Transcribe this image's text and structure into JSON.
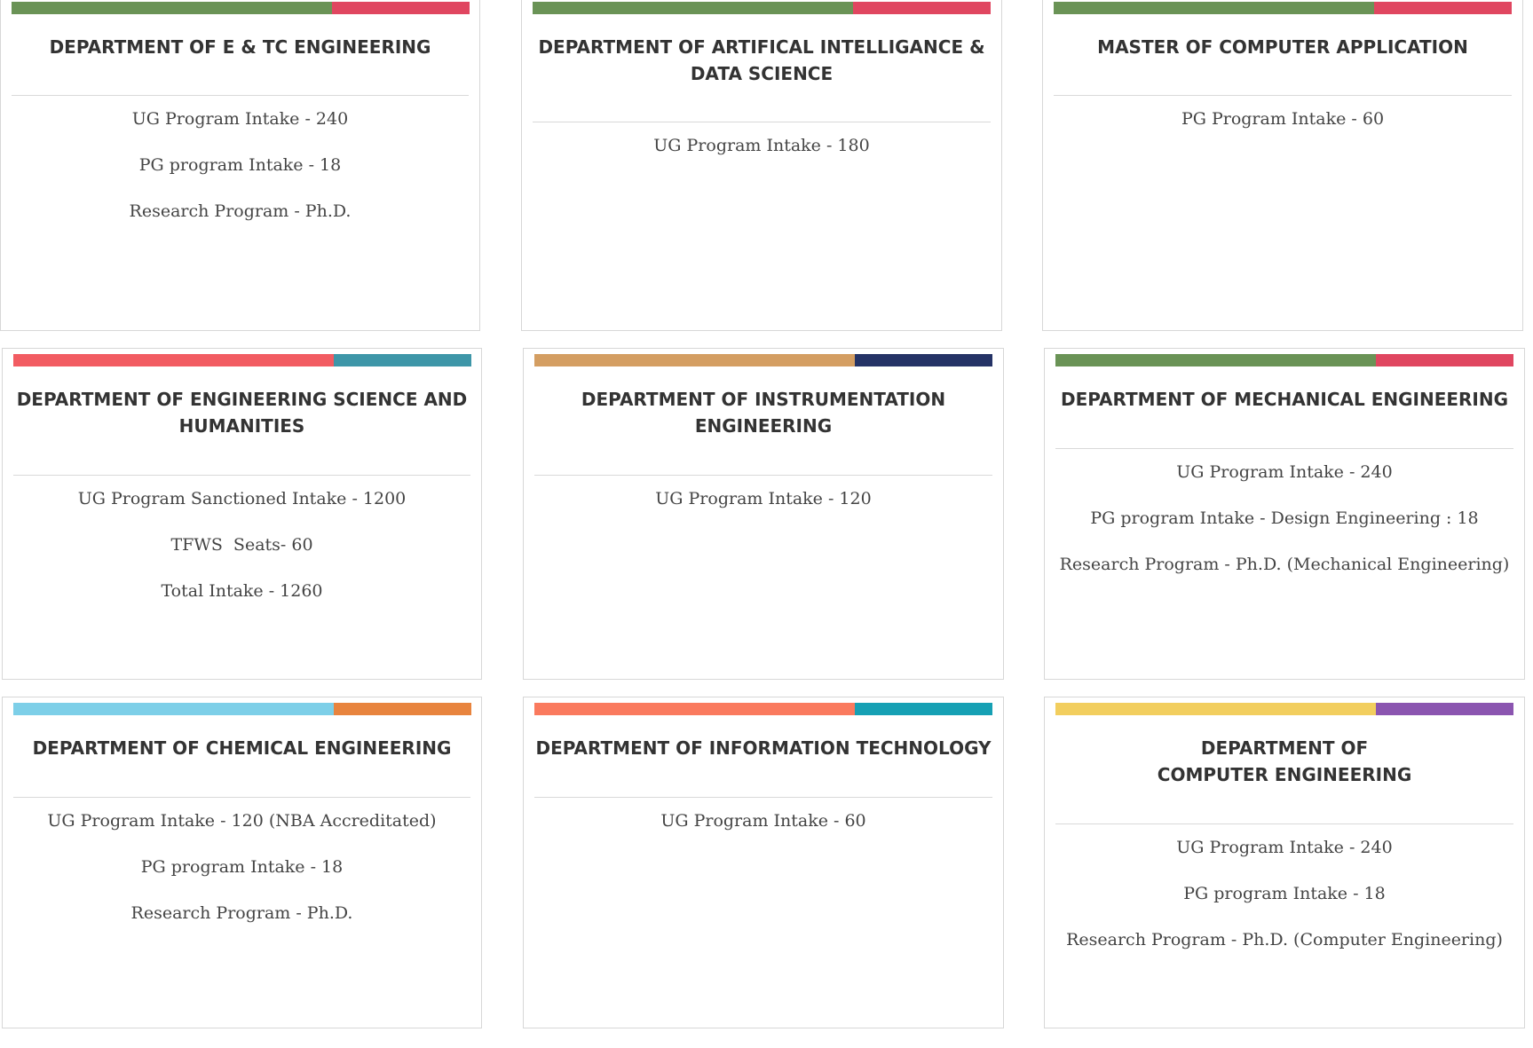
{
  "cards": [
    {
      "title": "DEPARTMENT OF E & TC ENGINEERING",
      "bar_colors": [
        "#6a9356",
        "#e04660"
      ],
      "lines": [
        "UG Program Intake - 240",
        "PG program Intake - 18",
        "Research Program - Ph.D."
      ]
    },
    {
      "title": "DEPARTMENT OF ARTIFICAL INTELLIGANCE &\nDATA SCIENCE",
      "bar_colors": [
        "#6a9356",
        "#e04660"
      ],
      "lines": [
        "UG Program Intake - 180"
      ]
    },
    {
      "title": "MASTER OF COMPUTER APPLICATION",
      "bar_colors": [
        "#6a9356",
        "#e04660"
      ],
      "lines": [
        "PG Program Intake - 60"
      ]
    },
    {
      "title": "DEPARTMENT OF ENGINEERING SCIENCE AND\nHUMANITIES",
      "bar_colors": [
        "#f25c62",
        "#3e96a8"
      ],
      "lines": [
        "UG Program Sanctioned Intake - 1200",
        "TFWS  Seats- 60",
        "Total Intake - 1260"
      ]
    },
    {
      "title": "DEPARTMENT OF INSTRUMENTATION\nENGINEERING",
      "bar_colors": [
        "#d49e62",
        "#253366"
      ],
      "lines": [
        "UG Program Intake - 120"
      ]
    },
    {
      "title": "DEPARTMENT OF MECHANICAL ENGINEERING",
      "bar_colors": [
        "#6a9356",
        "#e04660"
      ],
      "lines": [
        "UG Program Intake - 240",
        "PG program Intake - Design Engineering : 18",
        "Research Program - Ph.D. (Mechanical Engineering)"
      ]
    },
    {
      "title": "DEPARTMENT OF CHEMICAL ENGINEERING",
      "bar_colors": [
        "#7dcfe8",
        "#e8843e"
      ],
      "lines": [
        "UG Program Intake - 120 (NBA Accreditated)",
        "PG program Intake - 18",
        "Research Program - Ph.D."
      ]
    },
    {
      "title": "DEPARTMENT OF INFORMATION TECHNOLOGY",
      "bar_colors": [
        "#fa7a5e",
        "#16a0b4"
      ],
      "lines": [
        "UG Program Intake - 60"
      ]
    },
    {
      "title": "DEPARTMENT OF\nCOMPUTER ENGINEERING",
      "bar_colors": [
        "#f2ce5e",
        "#8b55b0"
      ],
      "lines": [
        "UG Program Intake - 240",
        "PG program Intake - 18",
        "Research Program - Ph.D. (Computer Engineering)"
      ]
    }
  ]
}
